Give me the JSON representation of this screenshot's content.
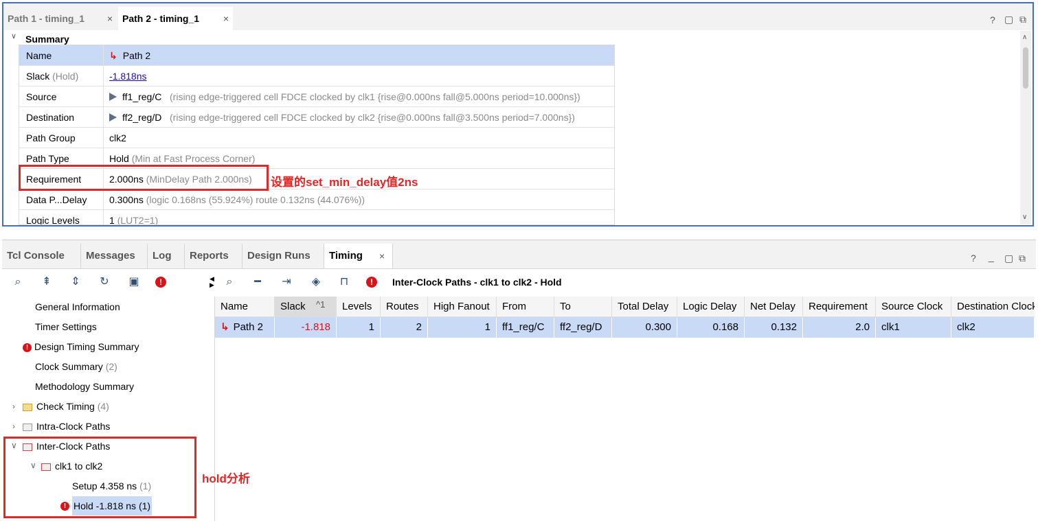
{
  "top_panel": {
    "tabs": [
      {
        "label": "Path 1 - timing_1",
        "close": "×"
      },
      {
        "label": "Path 2 - timing_1",
        "close": "×"
      }
    ],
    "controls": {
      "help": "?",
      "restore": "▢",
      "float": "⧉"
    },
    "section_title": "Summary",
    "rows": {
      "name": {
        "key": "Name",
        "value": "Path 2"
      },
      "slack": {
        "key": "Slack",
        "key_suffix": "(Hold)",
        "value": "-1.818ns"
      },
      "source": {
        "key": "Source",
        "value": "ff1_reg/C",
        "detail": "(rising edge-triggered cell FDCE clocked by clk1  {rise@0.000ns fall@5.000ns period=10.000ns})"
      },
      "destination": {
        "key": "Destination",
        "value": "ff2_reg/D",
        "detail": "(rising edge-triggered cell FDCE clocked by clk2  {rise@0.000ns fall@3.500ns period=7.000ns})"
      },
      "path_group": {
        "key": "Path Group",
        "value": "clk2"
      },
      "path_type": {
        "key": "Path Type",
        "value": "Hold",
        "detail": "(Min at Fast Process Corner)"
      },
      "requirement": {
        "key": "Requirement",
        "value": "2.000ns",
        "detail": "(MinDelay Path 2.000ns)"
      },
      "data_path_delay": {
        "key": "Data P...Delay",
        "value": "0.300ns",
        "detail": "(logic 0.168ns (55.924%)  route 0.132ns (44.076%))"
      },
      "logic_levels": {
        "key": "Logic Levels",
        "value": "1",
        "detail": "(LUT2=1)"
      }
    }
  },
  "annotations": {
    "requirement_note": "设置的set_min_delay值2ns",
    "hold_note": "hold分析"
  },
  "bottom_panel": {
    "tabs": [
      {
        "label": "Tcl Console"
      },
      {
        "label": "Messages"
      },
      {
        "label": "Log"
      },
      {
        "label": "Reports"
      },
      {
        "label": "Design Runs"
      },
      {
        "label": "Timing",
        "close": "×"
      }
    ],
    "controls": {
      "help": "?",
      "minimize": "_",
      "restore": "▢",
      "float": "⧉"
    },
    "results_title": "Inter-Clock Paths - clk1 to clk2 - Hold",
    "tree": {
      "general_information": "General Information",
      "timer_settings": "Timer Settings",
      "design_timing_summary": "Design Timing Summary",
      "clock_summary": "Clock Summary",
      "clock_summary_count": "(2)",
      "methodology_summary": "Methodology Summary",
      "check_timing": "Check Timing",
      "check_timing_count": "(4)",
      "intra_clock_paths": "Intra-Clock Paths",
      "inter_clock_paths": "Inter-Clock Paths",
      "clk1_to_clk2": "clk1 to clk2",
      "setup": "Setup 4.358 ns",
      "setup_count": "(1)",
      "hold": "Hold -1.818 ns (1)"
    },
    "table": {
      "sort_indicator": "^1",
      "columns": [
        "Name",
        "Slack",
        "Levels",
        "Routes",
        "High Fanout",
        "From",
        "To",
        "Total Delay",
        "Logic Delay",
        "Net Delay",
        "Requirement",
        "Source Clock",
        "Destination Clock"
      ],
      "rows": [
        [
          "Path 2",
          "-1.818",
          "1",
          "2",
          "1",
          "ff1_reg/C",
          "ff2_reg/D",
          "0.300",
          "0.168",
          "0.132",
          "2.0",
          "clk1",
          "clk2"
        ]
      ]
    }
  },
  "colors": {
    "accent_blue": "#3f70c4",
    "selection": "#c9daf6",
    "error_red": "#d6141a",
    "annotation_red": "#e32626",
    "link_blue": "#1a0dab"
  }
}
